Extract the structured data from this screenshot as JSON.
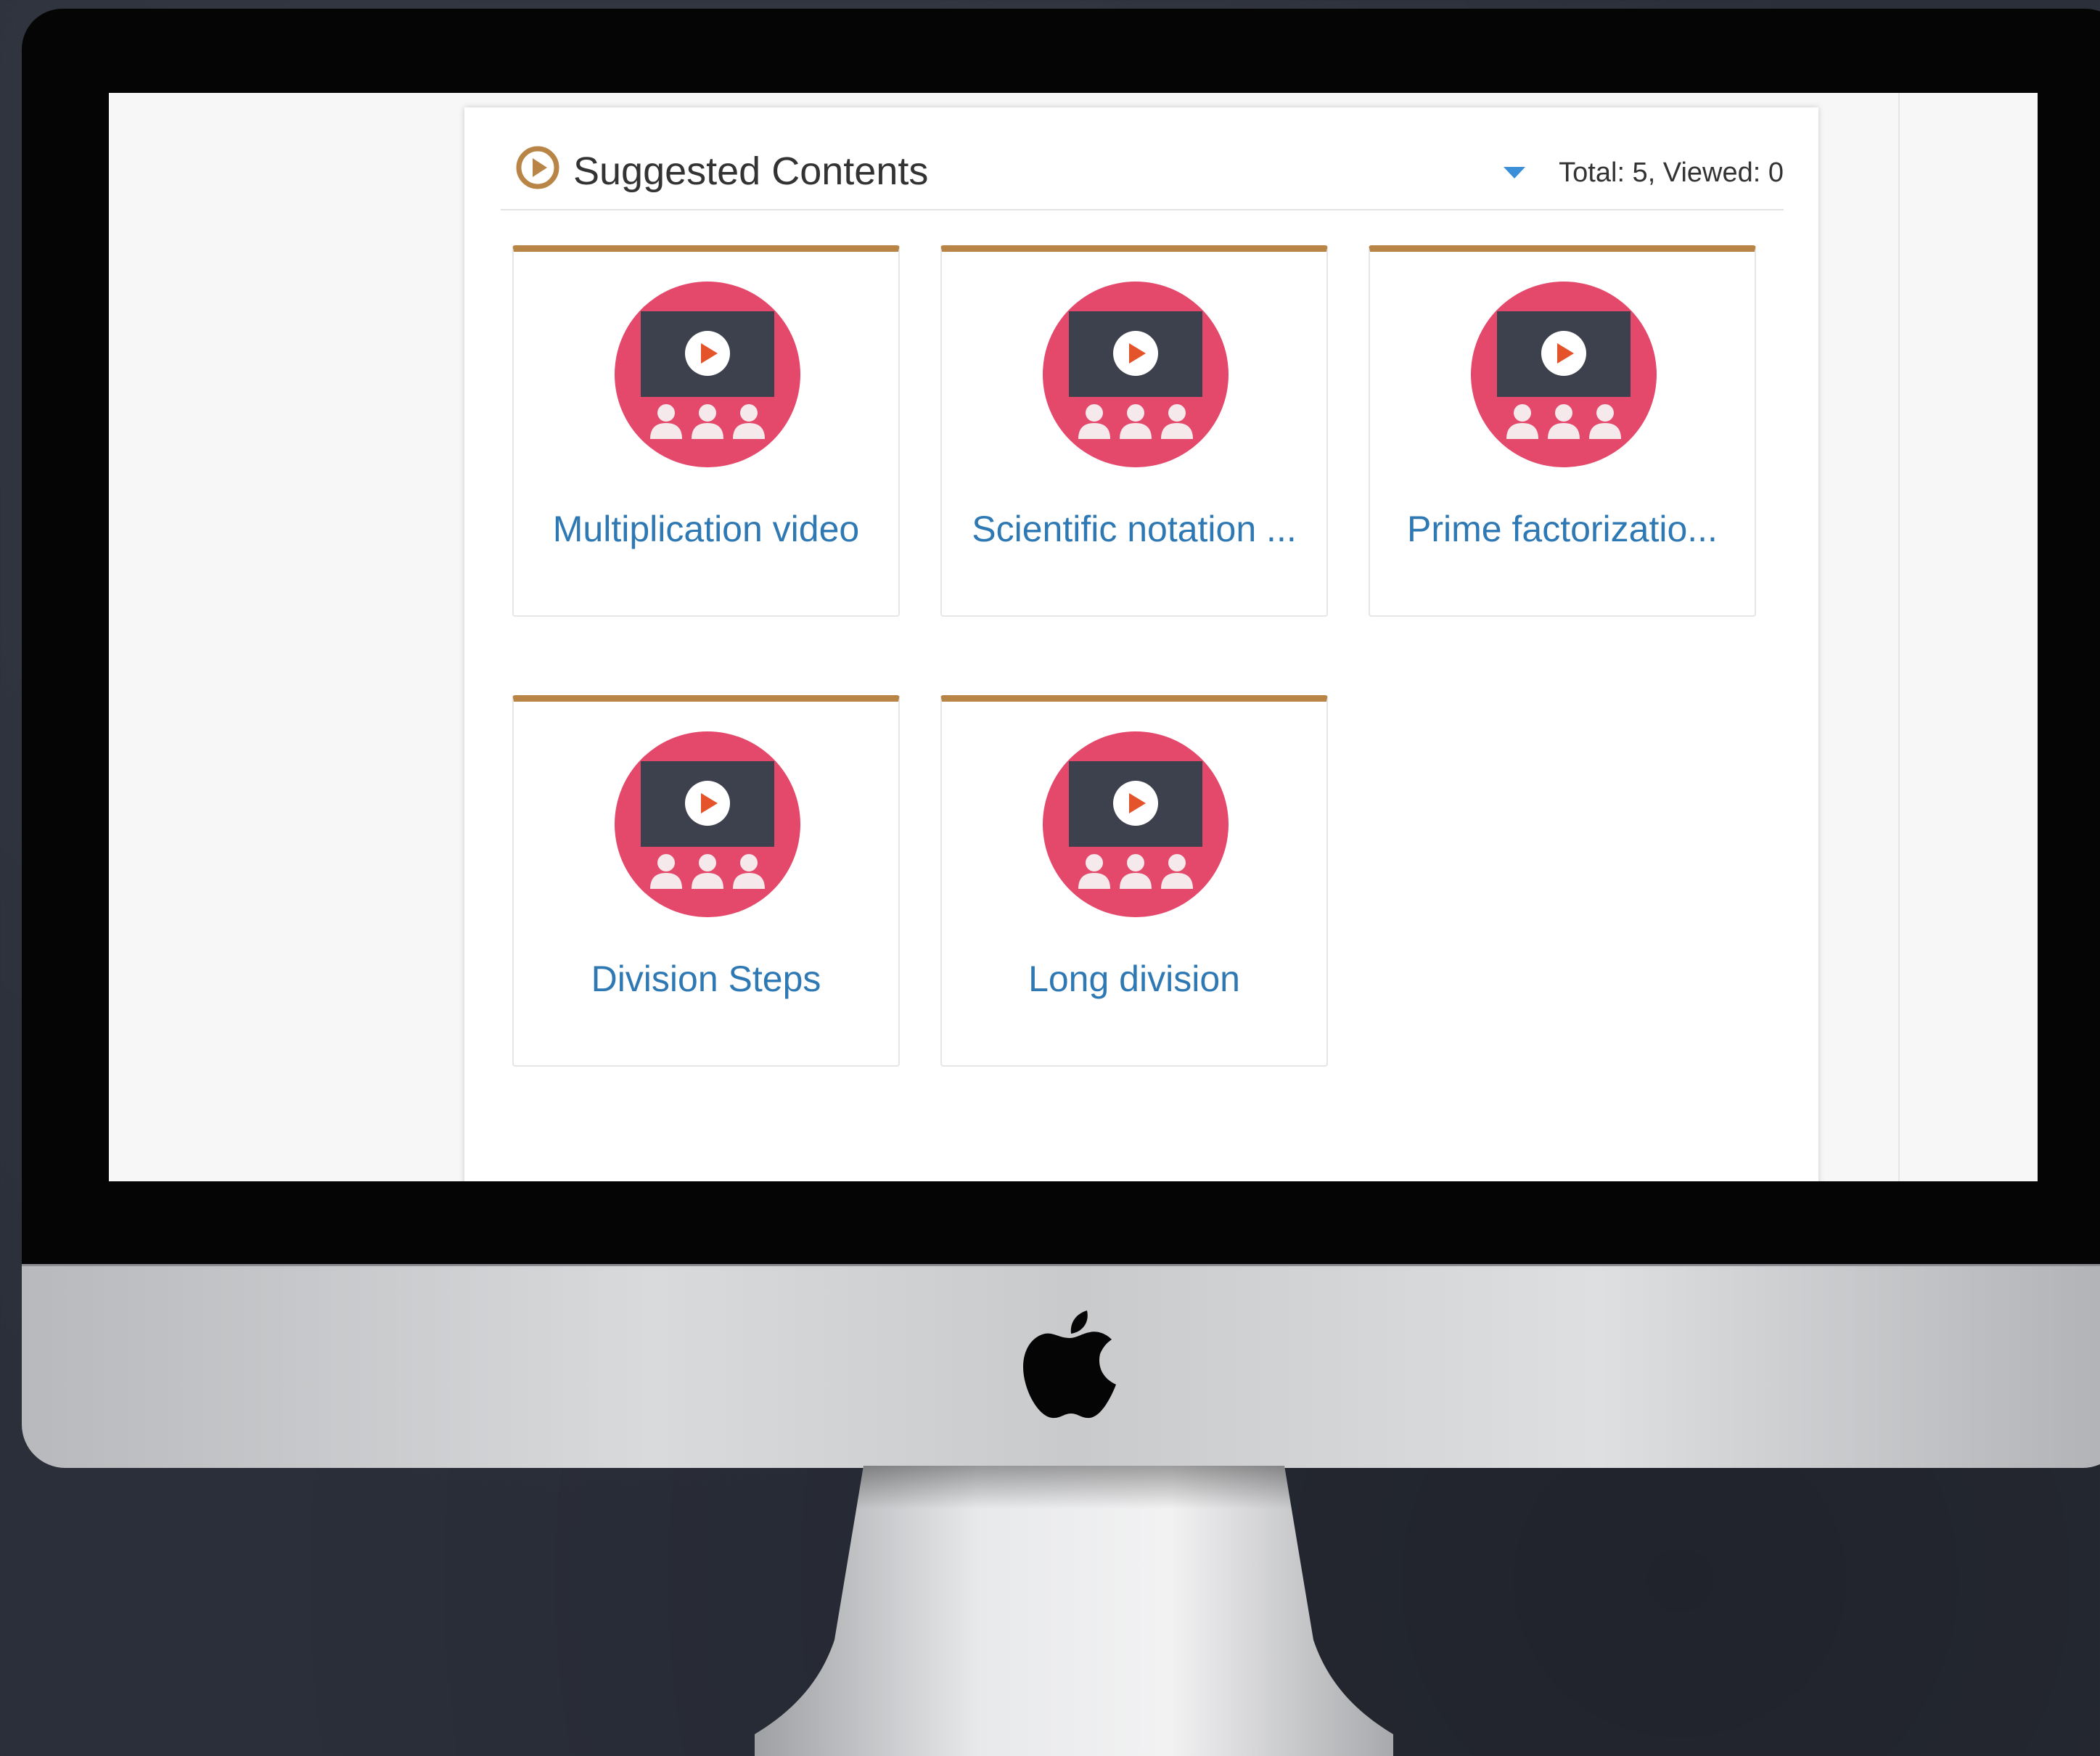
{
  "panel": {
    "title": "Suggested Contents",
    "summary": "Total: 5, Viewed: 0"
  },
  "cards": [
    {
      "title": "Multiplication video",
      "icon": "video-lesson-icon"
    },
    {
      "title": "Scientific notation ...",
      "icon": "video-lesson-icon"
    },
    {
      "title": "Prime factorizatio...",
      "icon": "video-lesson-icon"
    },
    {
      "title": "Division Steps",
      "icon": "video-lesson-icon"
    },
    {
      "title": "Long division",
      "icon": "video-lesson-icon"
    }
  ],
  "colors": {
    "accent": "#b98546",
    "link": "#2e78b4",
    "icon_circle": "#e4486a",
    "screen_dark": "#3d414d",
    "play": "#e4532a",
    "caret": "#3a8fd8"
  }
}
